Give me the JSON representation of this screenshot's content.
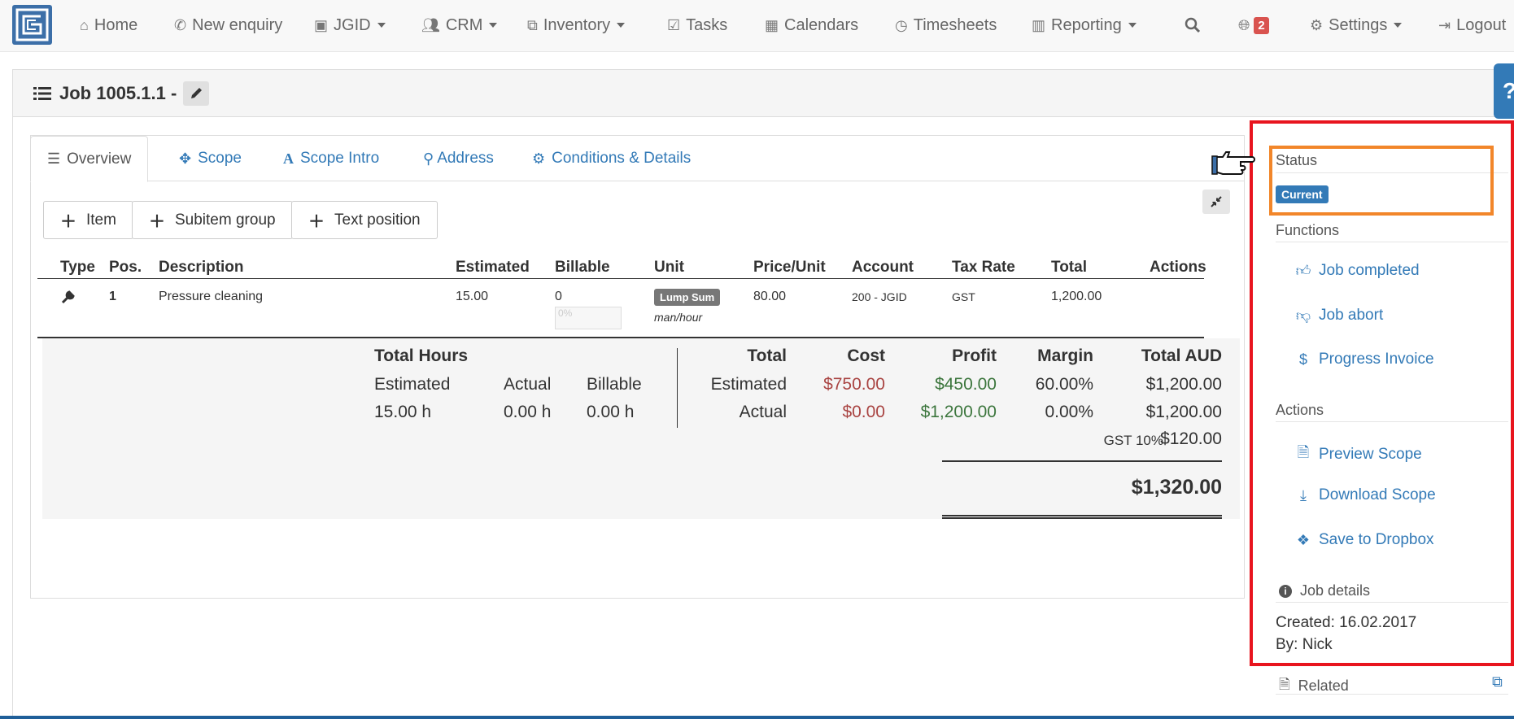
{
  "nav": {
    "home": "Home",
    "new_enquiry": "New enquiry",
    "jgid": "JGID",
    "crm": "CRM",
    "inventory": "Inventory",
    "tasks": "Tasks",
    "calendars": "Calendars",
    "timesheets": "Timesheets",
    "reporting": "Reporting",
    "notifications_count": "2",
    "settings": "Settings",
    "logout": "Logout"
  },
  "job": {
    "title": "Job 1005.1.1 -"
  },
  "tabs": [
    "Overview",
    "Scope",
    "Scope Intro",
    "Address",
    "Conditions & Details"
  ],
  "buttons": {
    "item": "Item",
    "subitem_group": "Subitem group",
    "text_position": "Text position"
  },
  "table": {
    "headers": [
      "Type",
      "Pos.",
      "Description",
      "Estimated",
      "Billable",
      "Unit",
      "Price/Unit",
      "Account",
      "Tax Rate",
      "Total",
      "Actions"
    ],
    "rows": [
      {
        "pos": "1",
        "description": "Pressure cleaning",
        "estimated": "15.00",
        "billable": "0",
        "billable_pct": "0%",
        "unit": "Lump Sum",
        "unit_sub": "man/hour",
        "price_unit": "80.00",
        "account": "200 - JGID",
        "tax_rate": "GST",
        "total": "1,200.00"
      }
    ]
  },
  "summary": {
    "total_hours": "Total Hours",
    "estimated_label": "Estimated",
    "actual_label": "Actual",
    "billable_label": "Billable",
    "est_hours": "15.00 h",
    "actual_hours": "0.00 h",
    "billable_hours": "0.00 h",
    "total_hdr": "Total",
    "cost_hdr": "Cost",
    "profit_hdr": "Profit",
    "margin_hdr": "Margin",
    "total_aud_hdr": "Total AUD",
    "row_estimated": "Estimated",
    "row_actual": "Actual",
    "est_cost": "$750.00",
    "est_profit": "$450.00",
    "est_margin": "60.00%",
    "est_total": "$1,200.00",
    "act_cost": "$0.00",
    "act_profit": "$1,200.00",
    "act_margin": "0.00%",
    "act_total": "$1,200.00",
    "gst_label": "GST 10%",
    "gst_value": "$120.00",
    "grand_total": "$1,320.00"
  },
  "side": {
    "status_title": "Status",
    "status_badge": "Current",
    "functions_title": "Functions",
    "job_completed": "Job completed",
    "job_abort": "Job abort",
    "progress_invoice": "Progress Invoice",
    "actions_title": "Actions",
    "preview_scope": "Preview Scope",
    "download_scope": "Download Scope",
    "save_dropbox": "Save to Dropbox",
    "job_details_title": "Job details",
    "created": "Created: 16.02.2017",
    "by": "By: Nick",
    "related_title": "Related"
  },
  "colors": {
    "link": "#337ab7",
    "highlight_red": "#e8141e",
    "highlight_orange": "#f2862a",
    "cost_red": "#a94442",
    "profit_green": "#3c763d"
  }
}
